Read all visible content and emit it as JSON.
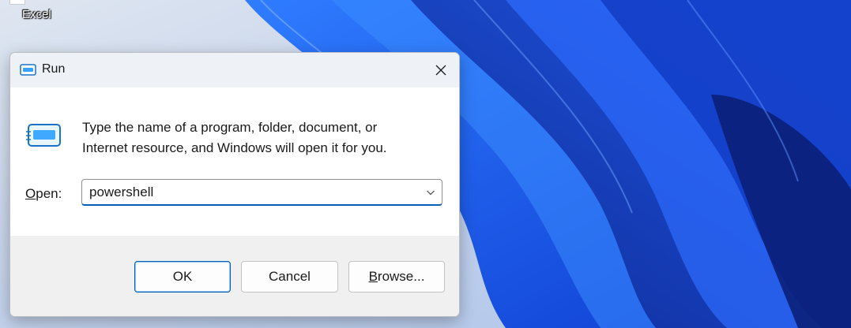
{
  "desktop": {
    "shortcut_label": "Excel"
  },
  "dialog": {
    "title": "Run",
    "description_line1": "Type the name of a program, folder, document, or",
    "description_line2": "Internet resource, and Windows will open it for you.",
    "open_label_accel": "O",
    "open_label_rest": "pen:",
    "open_value": "powershell",
    "ok_label": "OK",
    "cancel_label": "Cancel",
    "browse_label_accel": "B",
    "browse_label_rest": "rowse..."
  },
  "icons": {
    "title": "run-icon",
    "big": "run-icon",
    "close": "close-icon",
    "dropdown": "chevron-down-icon"
  },
  "colors": {
    "accent": "#005fb8",
    "wallpaper_primary": "#1a5cf0",
    "wallpaper_dark": "#0a2a8a"
  }
}
